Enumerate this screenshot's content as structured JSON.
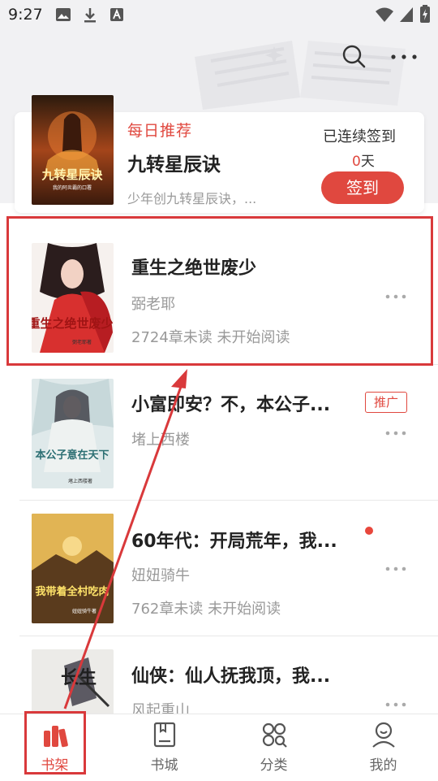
{
  "status_bar": {
    "time": "9:27"
  },
  "recommend": {
    "tag": "每日推荐",
    "title": "九转星辰诀",
    "description": "少年创九转星辰诀，...",
    "cover_text": "九转星辰诀",
    "cover_subtext": "我的阿炎霸的口署"
  },
  "checkin": {
    "label": "已连续签到",
    "days_number": "0",
    "days_unit": "天",
    "button_label": "签到"
  },
  "books": [
    {
      "title": "重生之绝世废少",
      "author": "弼老耶",
      "status": "2724章未读  未开始阅读",
      "cover_text": "重生之绝世废少",
      "cover_sub": "弼老耶著"
    },
    {
      "title": "小富即安？不，本公子...",
      "author": "堵上西楼",
      "badge": "推广",
      "cover_text": "本公子意在天下",
      "cover_sub": "堵上西楼著"
    },
    {
      "title": "60年代：开局荒年，我...",
      "author": "妞妞骑牛",
      "status": "762章未读  未开始阅读",
      "cover_text": "我带着全村吃肉",
      "cover_sub": "妞妞骑牛著"
    },
    {
      "title": "仙侠：仙人抚我顶，我...",
      "author": "风起重山",
      "cover_text": "长生"
    }
  ],
  "nav": [
    {
      "label": "书架",
      "icon": "bookshelf-icon",
      "active": true
    },
    {
      "label": "书城",
      "icon": "bookstore-icon",
      "active": false
    },
    {
      "label": "分类",
      "icon": "category-icon",
      "active": false
    },
    {
      "label": "我的",
      "icon": "profile-icon",
      "active": false
    }
  ],
  "colors": {
    "accent": "#e0483f",
    "annotation": "#d9393b"
  }
}
